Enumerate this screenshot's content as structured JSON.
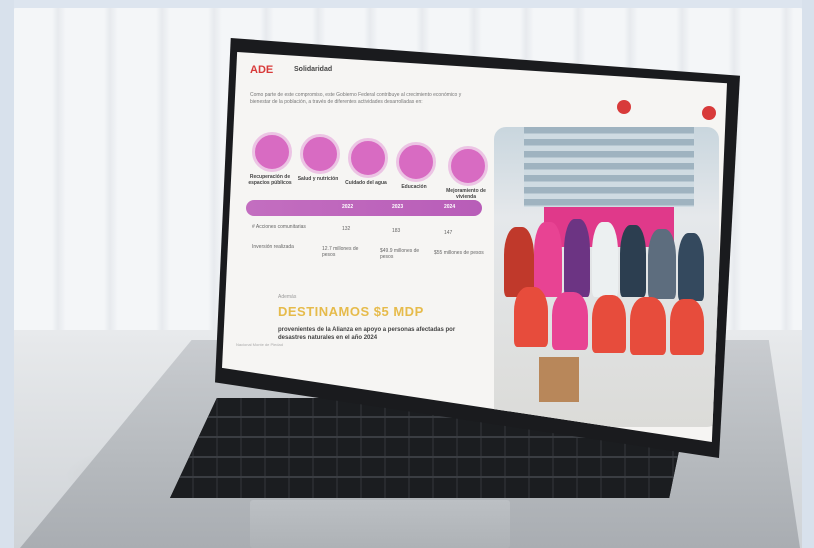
{
  "screen": {
    "logo_primary": "ADE",
    "logo_secondary": "Solidaridad",
    "intro_text": "Como parte de este compromiso, este Gobierno Federal contribuye al crecimiento económico y bienestar de la población, a través de diferentes actividades desarrolladas en:",
    "icons": [
      {
        "label": "Recuperación de espacios públicos",
        "icon": "park-icon"
      },
      {
        "label": "Salud y nutrición",
        "icon": "health-icon"
      },
      {
        "label": "Cuidado del agua",
        "icon": "water-icon"
      },
      {
        "label": "Educación",
        "icon": "education-icon"
      },
      {
        "label": "Mejoramiento de vivienda",
        "icon": "house-icon"
      }
    ],
    "years": [
      "2022",
      "2023",
      "2024"
    ],
    "rows": [
      {
        "label": "# Acciones comunitarias",
        "values": [
          "132",
          "183",
          "147"
        ]
      },
      {
        "label": "Inversión realizada",
        "values": [
          "12.7 millones de pesos",
          "$49.9 millones de pesos",
          "$55 millones de pesos"
        ]
      }
    ],
    "highlight_label": "Además",
    "headline": "DESTINAMOS $5 MDP",
    "subline": "provenientes de la Alianza en apoyo a personas afectadas por desastres naturales en el año 2024",
    "footer": "Nacional Monte de Piedad"
  },
  "colors": {
    "accent_pink": "#d86bc2",
    "accent_red": "#d83a3a",
    "headline_gold": "#e6bb4b"
  }
}
